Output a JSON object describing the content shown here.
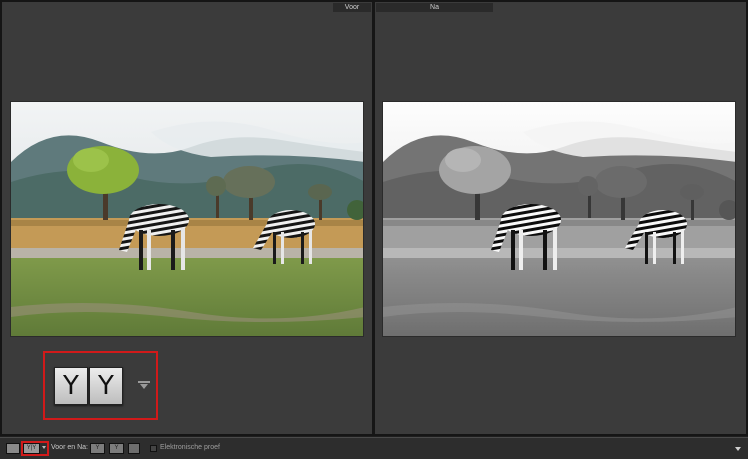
{
  "labels": {
    "before": "Voor",
    "after": "Na"
  },
  "callout": {
    "left_button_glyph": "Y",
    "right_button_glyph": "Y",
    "menu_icon": "triangle-down-icon"
  },
  "toolbar": {
    "loupe_icon": "single-view-icon",
    "compare_button_glyph": "Y|Y",
    "view_label": "Voor en Na:",
    "swap_left_glyph": "Y",
    "swap_right_glyph": "Y",
    "proof_label": "Elektronische proef",
    "menu_icon": "dropdown-arrow-icon"
  },
  "colors": {
    "callout_highlight": "#d11a1a",
    "pane_background": "#3b3b3b"
  }
}
